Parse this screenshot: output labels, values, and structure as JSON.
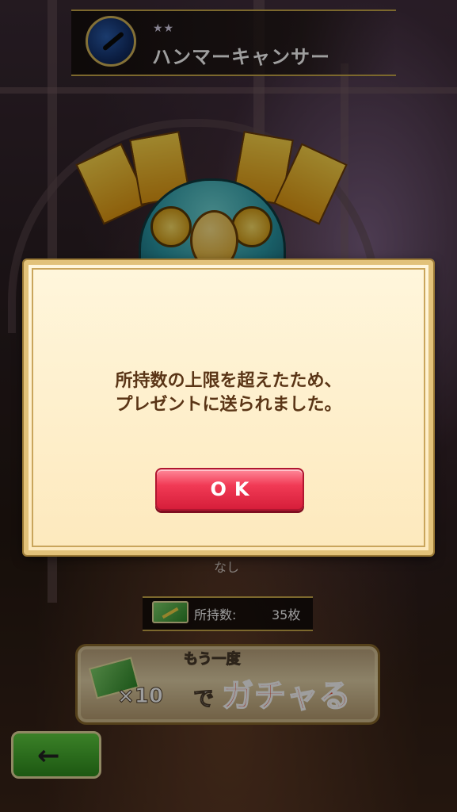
{
  "header": {
    "rarity": "★★",
    "monster_name": "ハンマーキャンサー"
  },
  "bottom": {
    "none_label": "なし",
    "owned_label": "所持数:",
    "owned_count": "35枚",
    "gacha_count": "×10",
    "gacha_again": "もう一度",
    "gacha_de": "で",
    "gacha_label": "ガチャる"
  },
  "dialog": {
    "message": "所持数の上限を超えたため、\nプレゼントに送られました。",
    "ok_label": "OK"
  },
  "colors": {
    "dialog_bg": "#fdf0cf",
    "ok_button": "#e8304d",
    "back_button": "#3fa82a",
    "gacha_label": "#e8432a"
  },
  "icons": [
    "element-icon",
    "ticket-icon",
    "back-arrow-icon"
  ]
}
